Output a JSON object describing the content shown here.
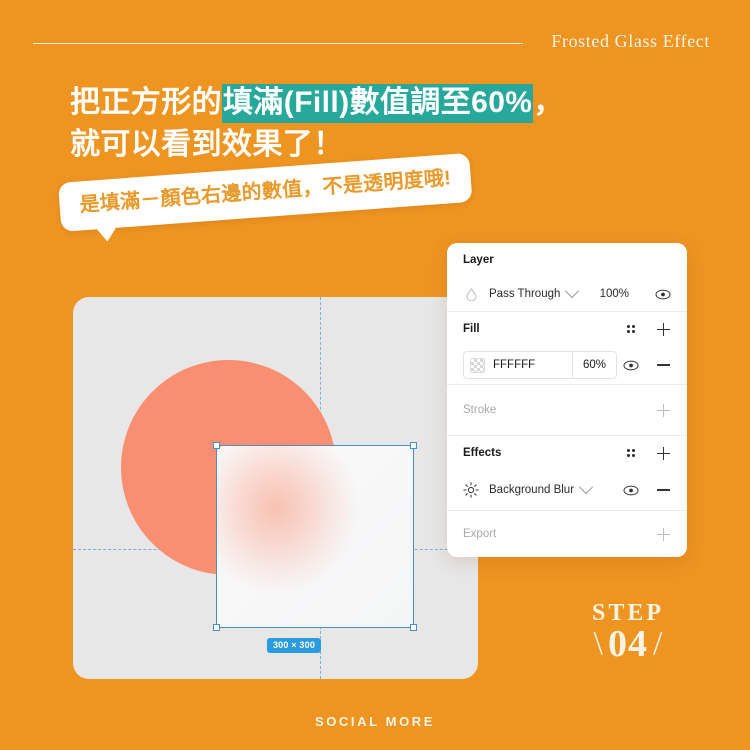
{
  "background_color": "#EE9421",
  "header": {
    "title": "Frosted Glass Effect",
    "rule": "horizontal-rule"
  },
  "heading": {
    "line1_prefix": "把正方形的",
    "line1_highlight": "填滿(Fill)數值調至60%",
    "line1_suffix": "，",
    "line2": "就可以看到效果了！",
    "highlight_color": "#27A89B",
    "text_color": "#FFFFFF"
  },
  "callout": {
    "text": "是填滿－顏色右邊的數值，不是透明度哦!",
    "text_color": "#E89B2C",
    "background": "#FFFFFF"
  },
  "canvas": {
    "background": "#E7E7E7",
    "circle_color": "#F98E71",
    "selection_color": "#4B8FC7",
    "size_badge": "300 × 300",
    "size_badge_color": "#2B9BE0"
  },
  "panel": {
    "layer": {
      "title": "Layer",
      "blend_mode": "Pass Through",
      "opacity": "100%",
      "blend_icon": "blend-mode-icon",
      "chevron": "chevron-down-icon",
      "visibility_icon": "eye-icon"
    },
    "fill": {
      "title": "Fill",
      "style_icon": "style-dots-icon",
      "add_icon": "plus-icon",
      "hex": "FFFFFF",
      "opacity": "60%",
      "swatch": "color-swatch-checkerboard",
      "visibility_icon": "eye-icon",
      "remove_icon": "minus-icon"
    },
    "stroke": {
      "title": "Stroke",
      "add_icon": "plus-icon",
      "disabled": true
    },
    "effects": {
      "title": "Effects",
      "style_icon": "style-dots-icon",
      "add_icon": "plus-icon",
      "effect_name": "Background Blur",
      "effect_icon": "brightness-sun-icon",
      "chevron": "chevron-down-icon",
      "visibility_icon": "eye-icon",
      "remove_icon": "minus-icon"
    },
    "export": {
      "title": "Export",
      "add_icon": "plus-icon",
      "disabled": true
    }
  },
  "step": {
    "label": "STEP",
    "number": "04",
    "slash_left": "\\",
    "slash_right": "/"
  },
  "footer": {
    "brand": "SOCIAL MORE"
  }
}
